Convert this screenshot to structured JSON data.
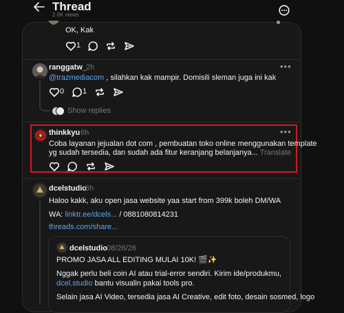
{
  "header": {
    "title": "Thread",
    "views": "2.6K views",
    "back_icon": "arrow-left-icon",
    "options_icon": "more-circle-icon"
  },
  "posts": [
    {
      "text": "OK, Kak",
      "likes": "1",
      "replies": "0"
    },
    {
      "username": "ranggatw_",
      "time": "2h",
      "mention": "@trazmediacom",
      "text": " , silahkan kak mampir. Domisili sleman juga ini kak",
      "likes": "0",
      "replies": "1",
      "show_replies": "Show replies"
    },
    {
      "username": "thinkkyu",
      "time": "6h",
      "text_line1": "Coba layanan jejualan dot com , pembuatan toko online menggunakan template",
      "text_line2": "yg sudah tersedia, dan sudah ada fitur keranjang belanjanya...",
      "translate": "Translate",
      "highlight_color": "#d9161f"
    },
    {
      "username": "dcelstudio",
      "time": "6h",
      "text": "Haloo kakk, aku open jasa website yaa start from 399k boleh DM/WA",
      "wa_prefix": "WA: ",
      "wa_link": "linktr.ee/dcels...",
      "wa_suffix": " / 0881080814231",
      "threads_link": "threads.com/share..."
    }
  ],
  "quoted": {
    "username": "dcelstudio",
    "date": "08/26/26",
    "headline": "PROMO JASA ALL EDITING MULAI 10K! 🎬✨",
    "line1": "Nggak perlu beli coin AI atau trial-error sendiri. Kirim ide/produkmu,",
    "line2_link": "dcel.studio",
    "line2_rest": " bantu visualin pakai tools pro.",
    "line3": "Selain jasa AI Video, tersedia jasa AI Creative, edit foto, desain sosmed, logo"
  },
  "colors": {
    "background": "#101010",
    "card": "#181818",
    "link": "#5da7f5",
    "highlight": "#d9161f"
  }
}
